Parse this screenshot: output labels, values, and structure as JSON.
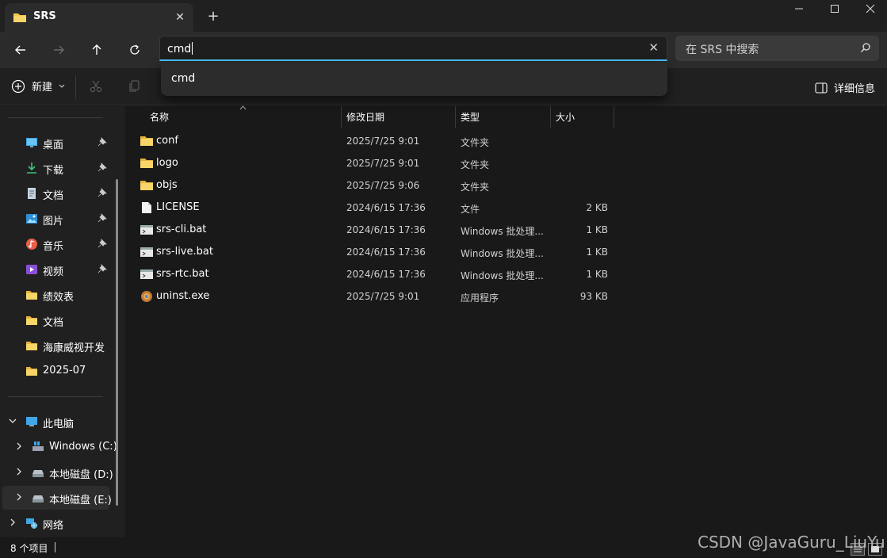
{
  "window": {
    "tab_title": "SRS",
    "tab_close": "✕",
    "new_tab": "+",
    "minimize": "—",
    "maximize": "☐",
    "close": "✕"
  },
  "nav": {
    "address_value": "cmd",
    "address_clear": "✕",
    "search_placeholder": "在 SRS 中搜索"
  },
  "autocomplete": {
    "items": [
      "cmd"
    ]
  },
  "commandbar": {
    "new_label": "新建",
    "details_label": "详细信息"
  },
  "sidebar": {
    "quick_access": [
      {
        "label": "桌面",
        "icon": "desktop-icon",
        "pinned": true
      },
      {
        "label": "下载",
        "icon": "download-icon",
        "pinned": true
      },
      {
        "label": "文档",
        "icon": "document-icon",
        "pinned": true
      },
      {
        "label": "图片",
        "icon": "pictures-icon",
        "pinned": true
      },
      {
        "label": "音乐",
        "icon": "music-icon",
        "pinned": true
      },
      {
        "label": "视频",
        "icon": "video-icon",
        "pinned": true
      },
      {
        "label": "绩效表",
        "icon": "folder-icon",
        "pinned": false
      },
      {
        "label": "文档",
        "icon": "folder-icon",
        "pinned": false
      },
      {
        "label": "海康威视开发",
        "icon": "folder-icon",
        "pinned": false
      },
      {
        "label": "2025-07",
        "icon": "folder-icon",
        "pinned": false
      }
    ],
    "this_pc": "此电脑",
    "drives": [
      "Windows (C:)",
      "本地磁盘 (D:)",
      "本地磁盘 (E:)"
    ],
    "network": "网络"
  },
  "columns": {
    "name": "名称",
    "date": "修改日期",
    "type": "类型",
    "size": "大小"
  },
  "files": [
    {
      "name": "conf",
      "date": "2025/7/25 9:01",
      "type": "文件夹",
      "size": "",
      "icon": "folder-icon"
    },
    {
      "name": "logo",
      "date": "2025/7/25 9:01",
      "type": "文件夹",
      "size": "",
      "icon": "folder-icon"
    },
    {
      "name": "objs",
      "date": "2025/7/25 9:06",
      "type": "文件夹",
      "size": "",
      "icon": "folder-icon"
    },
    {
      "name": "LICENSE",
      "date": "2024/6/15 17:36",
      "type": "文件",
      "size": "2 KB",
      "icon": "file-icon"
    },
    {
      "name": "srs-cli.bat",
      "date": "2024/6/15 17:36",
      "type": "Windows 批处理...",
      "size": "1 KB",
      "icon": "batch-file-icon"
    },
    {
      "name": "srs-live.bat",
      "date": "2024/6/15 17:36",
      "type": "Windows 批处理...",
      "size": "1 KB",
      "icon": "batch-file-icon"
    },
    {
      "name": "srs-rtc.bat",
      "date": "2024/6/15 17:36",
      "type": "Windows 批处理...",
      "size": "1 KB",
      "icon": "batch-file-icon"
    },
    {
      "name": "uninst.exe",
      "date": "2025/7/25 9:01",
      "type": "应用程序",
      "size": "93 KB",
      "icon": "installer-icon"
    }
  ],
  "status": {
    "item_count": "8 个项目"
  },
  "watermark": "CSDN @JavaGuru_LiuYu",
  "colors": {
    "accent": "#4cc2ff",
    "folder": "#f4c64a",
    "background": "#191919"
  }
}
